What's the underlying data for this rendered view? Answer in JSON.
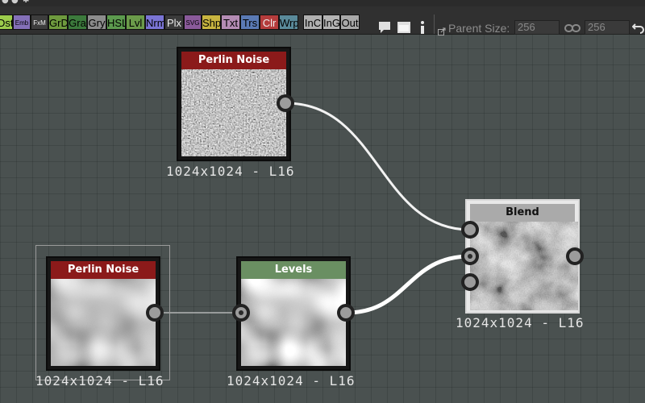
{
  "toolbar": {
    "node_buttons": [
      {
        "label": "Dst",
        "color": "#9ccc4c"
      },
      {
        "label": "Emb",
        "color": "#8470b8"
      },
      {
        "label": "FxM",
        "color": "#3d3d3d"
      },
      {
        "label": "GrD",
        "color": "#6e9a3e"
      },
      {
        "label": "Gra",
        "color": "#3c7a3c"
      },
      {
        "label": "Gry",
        "color": "#8c8c8c"
      },
      {
        "label": "HSL",
        "color": "#5c9a4e"
      },
      {
        "label": "Lvl",
        "color": "#6b9b4a"
      },
      {
        "label": "Nrm",
        "color": "#7a74d4"
      },
      {
        "label": "Plx",
        "color": "#3a3a3a"
      },
      {
        "label": "SVG",
        "color": "#8a5a9a"
      },
      {
        "label": "Shp",
        "color": "#c8b440"
      },
      {
        "label": "Txt",
        "color": "#b48cb4"
      },
      {
        "label": "Trs",
        "color": "#5a7ab4"
      },
      {
        "label": "Clr",
        "color": "#b43c3c"
      },
      {
        "label": "Wrp",
        "color": "#5a8a9a"
      },
      {
        "label": "InC",
        "color": "#b0b0b0"
      },
      {
        "label": "InG",
        "color": "#b4b4b4"
      },
      {
        "label": "Out",
        "color": "#a8a8a8"
      }
    ],
    "icons": [
      "comment-icon",
      "frame-icon",
      "info-icon"
    ],
    "parent_size_label": "Parent Size:",
    "parent_width": "256",
    "parent_height": "256",
    "link_icon": "chain-link-icon",
    "undo_icon": "undo-icon"
  },
  "nodes": [
    {
      "id": "perlin1",
      "title": "Perlin Noise",
      "header_color": "#8b1a1a",
      "size_label": "1024x1024 - L16",
      "preview": "fine-noise"
    },
    {
      "id": "perlin2",
      "title": "Perlin Noise",
      "header_color": "#8b1a1a",
      "size_label": "1024x1024 - L16",
      "preview": "smooth-noise",
      "selected": true
    },
    {
      "id": "levels",
      "title": "Levels",
      "header_color": "#6a8f62",
      "size_label": "1024x1024 - L16",
      "preview": "smooth-noise-contrast"
    },
    {
      "id": "blend",
      "title": "Blend",
      "header_color": "#aaaaaa",
      "size_label": "1024x1024 - L16",
      "preview": "blended-noise"
    }
  ]
}
